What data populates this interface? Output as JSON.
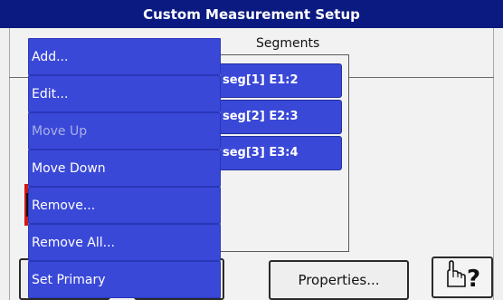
{
  "window": {
    "title": "Custom Measurement Setup"
  },
  "segments": {
    "caption": "Segments",
    "items": [
      {
        "label": "seg[1] E1:2"
      },
      {
        "label": "seg[2] E2:3"
      },
      {
        "label": "seg[3] E3:4"
      }
    ]
  },
  "context_menu": {
    "items": [
      {
        "label": "Add...",
        "enabled": true
      },
      {
        "label": "Edit...",
        "enabled": true
      },
      {
        "label": "Move Up",
        "enabled": false
      },
      {
        "label": "Move Down",
        "enabled": true
      },
      {
        "label": "Remove...",
        "enabled": true
      },
      {
        "label": "Remove All...",
        "enabled": true
      },
      {
        "label": "Set Primary",
        "enabled": true
      }
    ]
  },
  "buttons": {
    "properties": "Properties...",
    "help_icon": "pointing-hand-question-icon"
  },
  "colors": {
    "titlebar": "#0b1a80",
    "menu_item": "#3a48d8",
    "disabled_text": "#a8b0e8",
    "marker": "#d01818"
  }
}
